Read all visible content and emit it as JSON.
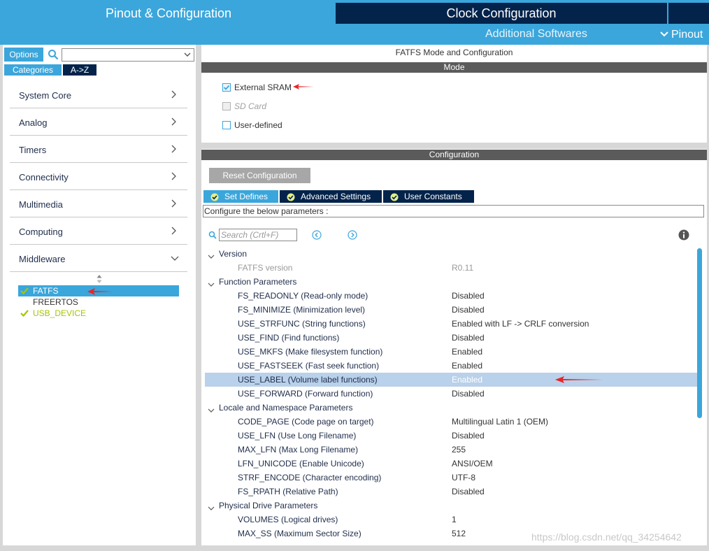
{
  "top_tabs": {
    "pinout": "Pinout & Configuration",
    "clock": "Clock Configuration"
  },
  "sub_nav": {
    "additional": "Additional Softwares",
    "pinout": "Pinout"
  },
  "left": {
    "options_label": "Options",
    "search_value": "",
    "categories_label": "Categories",
    "az_label": "A->Z",
    "categories": [
      {
        "label": "System Core"
      },
      {
        "label": "Analog"
      },
      {
        "label": "Timers"
      },
      {
        "label": "Connectivity"
      },
      {
        "label": "Multimedia"
      },
      {
        "label": "Computing"
      },
      {
        "label": "Middleware"
      }
    ],
    "middleware_items": [
      {
        "label": "FATFS",
        "selected": true,
        "ok": true
      },
      {
        "label": "FREERTOS",
        "selected": false,
        "ok": false
      },
      {
        "label": "USB_DEVICE",
        "selected": false,
        "ok": true
      }
    ]
  },
  "mode": {
    "title": "FATFS Mode and Configuration",
    "bar": "Mode",
    "options": [
      {
        "label": "External SRAM",
        "checked": true,
        "disabled": false
      },
      {
        "label": "SD Card",
        "checked": false,
        "disabled": true
      },
      {
        "label": "User-defined",
        "checked": false,
        "disabled": false
      }
    ]
  },
  "config": {
    "bar": "Configuration",
    "reset_label": "Reset Configuration",
    "tabs": [
      "Set Defines",
      "Advanced Settings",
      "User Constants"
    ],
    "hint": "Configure the below parameters :",
    "search_placeholder": "Search (Crtl+F)",
    "params": [
      {
        "type": "group",
        "label": "Version"
      },
      {
        "type": "param",
        "name": "FATFS version",
        "value": "R0.11",
        "dim": true
      },
      {
        "type": "group",
        "label": "Function Parameters"
      },
      {
        "type": "param",
        "name": "FS_READONLY (Read-only mode)",
        "value": "Disabled"
      },
      {
        "type": "param",
        "name": "FS_MINIMIZE (Minimization level)",
        "value": "Disabled"
      },
      {
        "type": "param",
        "name": "USE_STRFUNC (String functions)",
        "value": "Enabled with LF -> CRLF conversion"
      },
      {
        "type": "param",
        "name": "USE_FIND (Find functions)",
        "value": "Disabled"
      },
      {
        "type": "param",
        "name": "USE_MKFS (Make filesystem function)",
        "value": "Enabled"
      },
      {
        "type": "param",
        "name": "USE_FASTSEEK (Fast seek function)",
        "value": "Enabled"
      },
      {
        "type": "param",
        "name": "USE_LABEL (Volume label functions)",
        "value": "Enabled",
        "highlight": true
      },
      {
        "type": "param",
        "name": "USE_FORWARD (Forward function)",
        "value": "Disabled"
      },
      {
        "type": "group",
        "label": "Locale and Namespace Parameters"
      },
      {
        "type": "param",
        "name": "CODE_PAGE (Code page on target)",
        "value": "Multilingual Latin 1 (OEM)"
      },
      {
        "type": "param",
        "name": "USE_LFN (Use Long Filename)",
        "value": "Disabled"
      },
      {
        "type": "param",
        "name": "MAX_LFN (Max Long Filename)",
        "value": "255"
      },
      {
        "type": "param",
        "name": "LFN_UNICODE (Enable Unicode)",
        "value": "ANSI/OEM"
      },
      {
        "type": "param",
        "name": "STRF_ENCODE (Character encoding)",
        "value": "UTF-8"
      },
      {
        "type": "param",
        "name": "FS_RPATH (Relative Path)",
        "value": "Disabled"
      },
      {
        "type": "group",
        "label": "Physical Drive Parameters"
      },
      {
        "type": "param",
        "name": "VOLUMES (Logical drives)",
        "value": "1"
      },
      {
        "type": "param",
        "name": "MAX_SS (Maximum Sector Size)",
        "value": "512"
      }
    ]
  },
  "watermark": "https://blog.csdn.net/qq_34254642",
  "colors": {
    "accent": "#3ba6db",
    "dark": "#03234b",
    "ok_green": "#a8c400",
    "arrow_red": "#e8262a"
  }
}
